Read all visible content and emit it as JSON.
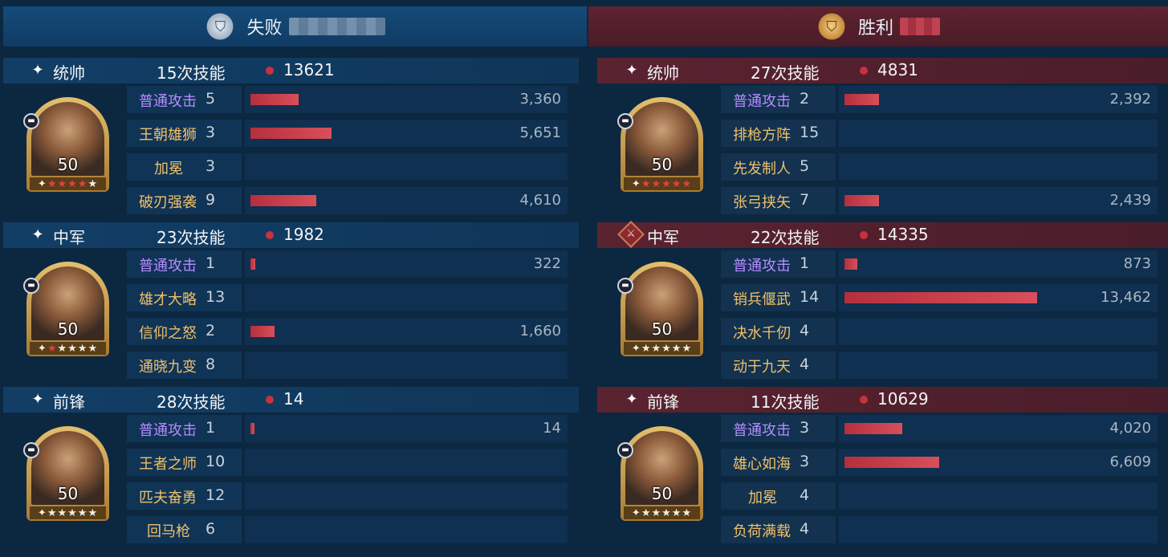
{
  "header": {
    "left": {
      "label": "失败"
    },
    "right": {
      "label": "胜利"
    }
  },
  "colors": {
    "bar": "#c73a47",
    "normal_attack_text": "#b58cff",
    "skill_text": "#f0c069",
    "lose_header": "#154b7a",
    "win_header": "#5e2330"
  },
  "chart_data": {
    "type": "bar",
    "sides": [
      {
        "result": "失败",
        "sections": [
          {
            "role": "统帅",
            "skill_casts": "15次技能",
            "damage": "13621",
            "level": "50",
            "stars_red": 4,
            "stars_total": 5,
            "skills": [
              {
                "name": "普通攻击",
                "count": "5",
                "value": 3360,
                "display": "3,360",
                "attack": true
              },
              {
                "name": "王朝雄狮",
                "count": "3",
                "value": 5651,
                "display": "5,651",
                "attack": false
              },
              {
                "name": "加冕",
                "count": "3",
                "value": null,
                "display": "",
                "attack": false
              },
              {
                "name": "破刃强袭",
                "count": "9",
                "value": 4610,
                "display": "4,610",
                "attack": false
              }
            ]
          },
          {
            "role": "中军",
            "skill_casts": "23次技能",
            "damage": "1982",
            "level": "50",
            "stars_red": 1,
            "stars_total": 5,
            "skills": [
              {
                "name": "普通攻击",
                "count": "1",
                "value": 322,
                "display": "322",
                "attack": true
              },
              {
                "name": "雄才大略",
                "count": "13",
                "value": null,
                "display": "",
                "attack": false
              },
              {
                "name": "信仰之怒",
                "count": "2",
                "value": 1660,
                "display": "1,660",
                "attack": false
              },
              {
                "name": "通晓九变",
                "count": "8",
                "value": null,
                "display": "",
                "attack": false
              }
            ]
          },
          {
            "role": "前锋",
            "skill_casts": "28次技能",
            "damage": "14",
            "level": "50",
            "stars_red": 0,
            "stars_total": 5,
            "skills": [
              {
                "name": "普通攻击",
                "count": "1",
                "value": 14,
                "display": "14",
                "attack": true
              },
              {
                "name": "王者之师",
                "count": "10",
                "value": null,
                "display": "",
                "attack": false
              },
              {
                "name": "匹夫奋勇",
                "count": "12",
                "value": null,
                "display": "",
                "attack": false
              },
              {
                "name": "回马枪",
                "count": "6",
                "value": null,
                "display": "",
                "attack": false
              }
            ]
          }
        ]
      },
      {
        "result": "胜利",
        "sections": [
          {
            "role": "统帅",
            "skill_casts": "27次技能",
            "damage": "4831",
            "level": "50",
            "stars_red": 5,
            "stars_total": 5,
            "skills": [
              {
                "name": "普通攻击",
                "count": "2",
                "value": 2392,
                "display": "2,392",
                "attack": true
              },
              {
                "name": "排枪方阵",
                "count": "15",
                "value": null,
                "display": "",
                "attack": false
              },
              {
                "name": "先发制人",
                "count": "5",
                "value": null,
                "display": "",
                "attack": false
              },
              {
                "name": "张弓挟矢",
                "count": "7",
                "value": 2439,
                "display": "2,439",
                "attack": false
              }
            ]
          },
          {
            "role": "中军",
            "skill_casts": "22次技能",
            "damage": "14335",
            "level": "50",
            "stars_red": 0,
            "stars_total": 5,
            "skills": [
              {
                "name": "普通攻击",
                "count": "1",
                "value": 873,
                "display": "873",
                "attack": true
              },
              {
                "name": "销兵偃武",
                "count": "14",
                "value": 13462,
                "display": "13,462",
                "attack": false
              },
              {
                "name": "决水千仞",
                "count": "4",
                "value": null,
                "display": "",
                "attack": false
              },
              {
                "name": "动于九天",
                "count": "4",
                "value": null,
                "display": "",
                "attack": false
              }
            ]
          },
          {
            "role": "前锋",
            "skill_casts": "11次技能",
            "damage": "10629",
            "level": "50",
            "stars_red": 0,
            "stars_total": 5,
            "skills": [
              {
                "name": "普通攻击",
                "count": "3",
                "value": 4020,
                "display": "4,020",
                "attack": true
              },
              {
                "name": "雄心如海",
                "count": "3",
                "value": 6609,
                "display": "6,609",
                "attack": false
              },
              {
                "name": "加冕",
                "count": "4",
                "value": null,
                "display": "",
                "attack": false
              },
              {
                "name": "负荷满载",
                "count": "4",
                "value": null,
                "display": "",
                "attack": false
              }
            ]
          }
        ]
      }
    ]
  }
}
